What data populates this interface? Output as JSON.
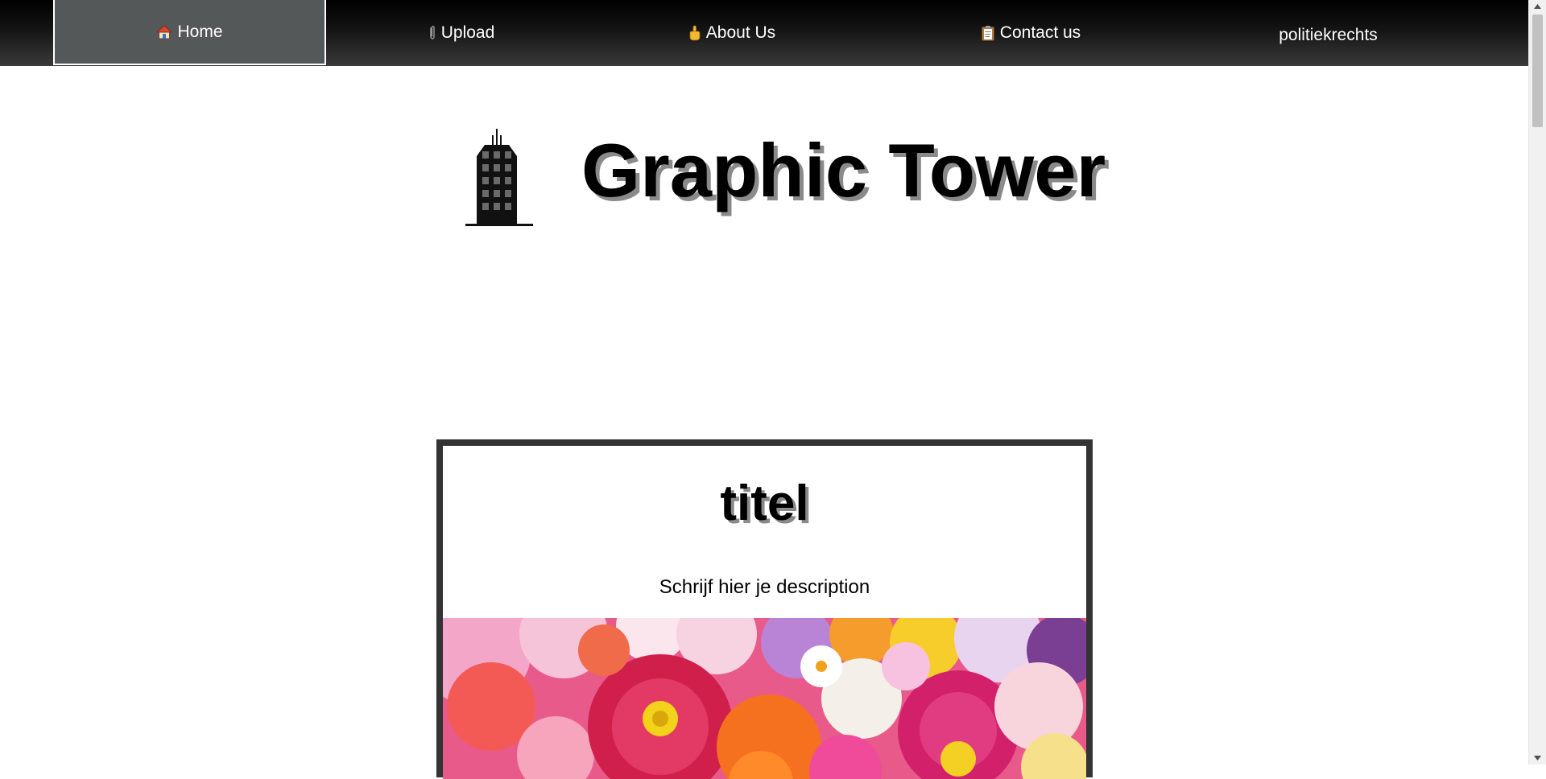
{
  "nav": {
    "items": [
      {
        "label": "Home",
        "icon": "home-icon",
        "active": true
      },
      {
        "label": "Upload",
        "icon": "paperclip-icon",
        "active": false
      },
      {
        "label": "About Us",
        "icon": "pointing-hand-icon",
        "active": false
      },
      {
        "label": "Contact us",
        "icon": "clipboard-icon",
        "active": false
      },
      {
        "label": "politiekrechts",
        "icon": "",
        "active": false
      }
    ]
  },
  "header": {
    "title": "Graphic Tower",
    "logo_icon": "office-building-icon"
  },
  "post": {
    "title": "titel",
    "description": "Schrijf hier je description",
    "image": "flowers-photo"
  },
  "colors": {
    "nav_active_bg": "#545859",
    "card_border": "#333333",
    "title_shadow": "#8a8a8a"
  }
}
